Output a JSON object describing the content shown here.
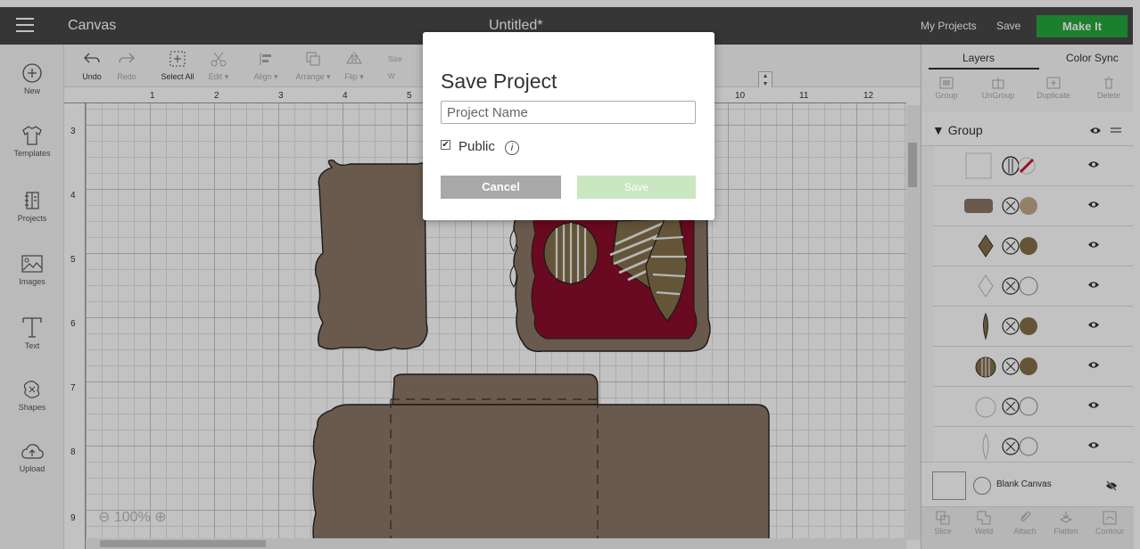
{
  "header": {
    "app_title": "Canvas",
    "doc_title": "Untitled*",
    "my_projects": "My Projects",
    "save": "Save",
    "make_it": "Make It"
  },
  "left_nav": [
    {
      "label": "New",
      "icon": "plus-circle-icon"
    },
    {
      "label": "Templates",
      "icon": "tshirt-icon"
    },
    {
      "label": "Projects",
      "icon": "projects-icon"
    },
    {
      "label": "Images",
      "icon": "image-icon"
    },
    {
      "label": "Text",
      "icon": "text-icon"
    },
    {
      "label": "Shapes",
      "icon": "shapes-icon"
    },
    {
      "label": "Upload",
      "icon": "upload-icon"
    }
  ],
  "toolbar": {
    "undo": "Undo",
    "redo": "Redo",
    "select_all": "Select All",
    "edit": "Edit ▾",
    "align": "Align ▾",
    "arrange": "Arrange ▾",
    "flip": "Flip ▾",
    "size": "Size",
    "w": "W"
  },
  "canvas": {
    "ruler_top": [
      "1",
      "2",
      "3",
      "4",
      "5",
      "10",
      "11",
      "12"
    ],
    "ruler_left": [
      "3",
      "4",
      "5",
      "6",
      "7",
      "8",
      "9"
    ],
    "zoom": "100%"
  },
  "layers_panel": {
    "tabs": [
      "Layers",
      "Color Sync"
    ],
    "tools": [
      "Group",
      "UnGroup",
      "Duplicate",
      "Delete"
    ],
    "group_label": "Group",
    "blank_canvas": "Blank Canvas",
    "bottom_tools": [
      "Slice",
      "Weld",
      "Attach",
      "Flatten",
      "Contour"
    ],
    "layers": [
      {
        "color": "#ffffff",
        "shape": "card"
      },
      {
        "color": "#8a7766",
        "shape": "envelope"
      },
      {
        "color": "#85704a",
        "shape": "ornament-diamond"
      },
      {
        "color": "#ffffff",
        "shape": "ornament-diamond"
      },
      {
        "color": "#85704a",
        "shape": "ornament-drop"
      },
      {
        "color": "#85704a",
        "shape": "ornament-round"
      },
      {
        "color": "#ffffff",
        "shape": "ornament-round"
      },
      {
        "color": "#ffffff",
        "shape": "ornament-drop"
      }
    ]
  },
  "modal": {
    "title": "Save Project",
    "placeholder": "Project Name",
    "public_label": "Public",
    "public_checked": true,
    "cancel": "Cancel",
    "save": "Save"
  },
  "colors": {
    "header_bg": "#474747",
    "make_it_green": "#25a73d",
    "card_tan": "#8a7766",
    "card_red": "#8b0e2b",
    "ornament_gold": "#85704a"
  }
}
